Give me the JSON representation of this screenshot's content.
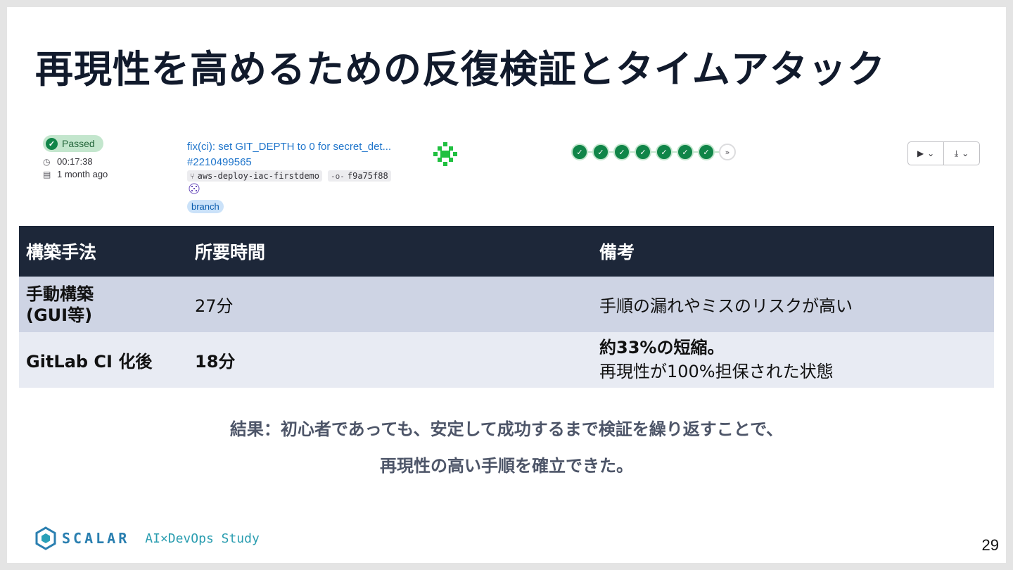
{
  "slide": {
    "title": "再現性を高めるための反復検証とタイムアタック",
    "page_number": "29"
  },
  "pipeline": {
    "status": "Passed",
    "duration": "00:17:38",
    "created": "1 month ago",
    "commit_title": "fix(ci): set GIT_DEPTH to 0 for secret_det...",
    "pipeline_id": "#2210499565",
    "branch_ref": "aws-deploy-iac-firstdemo",
    "commit_sha": "f9a75f88",
    "tag": "branch",
    "stages_passed": 7
  },
  "table": {
    "headers": [
      "構築手法",
      "所要時間",
      "備考"
    ],
    "rows": [
      {
        "method": "手動構築(GUI等)",
        "method_line1": "手動構築",
        "method_line2": "(GUI等)",
        "time": "27分",
        "note_line1": "手順の漏れやミスのリスクが高い",
        "note_line2": ""
      },
      {
        "method": "GitLab CI 化後",
        "time": "18分",
        "note_line1": "約33%の短縮。",
        "note_line2": "再現性が100%担保された状態"
      }
    ]
  },
  "conclusion": {
    "line1": "結果：初心者であっても、安定して成功するまで検証を繰り返すことで、",
    "line2": "再現性の高い手順を確立できた。"
  },
  "footer": {
    "logo": "SCALAR",
    "study": "AI×DevOps Study"
  },
  "colors": {
    "header_bg": "#1d2739",
    "row1_bg": "#ced4e4",
    "row2_bg": "#e8ebf3",
    "success_green": "#108548",
    "link_blue": "#1f75cb"
  }
}
